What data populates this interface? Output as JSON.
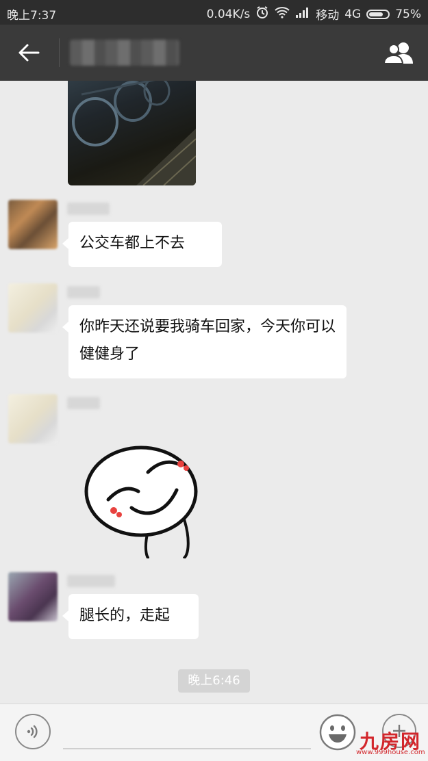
{
  "status_bar": {
    "time": "晚上7:37",
    "network_speed": "0.04K/s",
    "carrier": "移动",
    "network_type": "4G",
    "battery": "75%",
    "battery_level": 0.75
  },
  "header": {
    "title": "",
    "back_icon": "arrow-left-icon",
    "contacts_icon": "group-contacts-icon"
  },
  "messages": [
    {
      "type": "image"
    },
    {
      "type": "text",
      "text": "公交车都上不去"
    },
    {
      "type": "text",
      "text": "你昨天还说要我骑车回家，今天你可以健健身了"
    },
    {
      "type": "sticker"
    },
    {
      "type": "text",
      "text": "腿长的，走起"
    }
  ],
  "timestamp": "晚上6:46",
  "input_bar": {
    "voice_icon": "voice-icon",
    "emoji_icon": "emoji-icon",
    "more_icon": "plus-icon"
  },
  "watermark": {
    "title": "九房网",
    "url": "www.999house.com"
  },
  "colors": {
    "title_bar": "#3a3a3a",
    "status_bar": "#2d2d2d",
    "chat_background": "#ebebeb",
    "bubble": "#ffffff",
    "watermark": "#d2262b"
  }
}
